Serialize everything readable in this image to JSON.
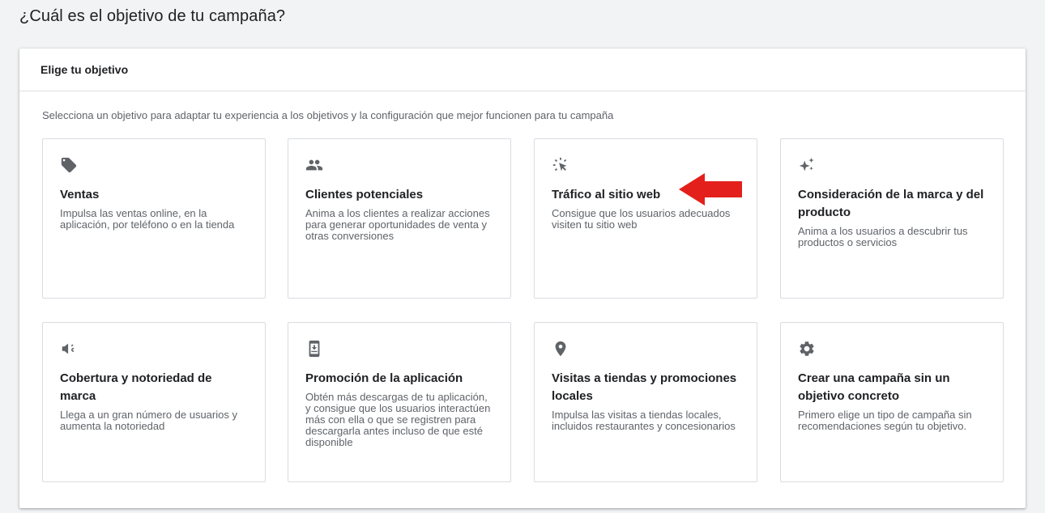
{
  "page": {
    "title": "¿Cuál es el objetivo de tu campaña?"
  },
  "panel": {
    "header": "Elige tu objetivo",
    "description": "Selecciona un objetivo para adaptar tu experiencia a los objetivos y la configuración que mejor funcionen para tu campaña"
  },
  "cards": [
    {
      "icon": "tag-icon",
      "title": "Ventas",
      "description": "Impulsa las ventas online, en la aplicación, por teléfono o en la tienda"
    },
    {
      "icon": "people-icon",
      "title": "Clientes potenciales",
      "description": "Anima a los clientes a realizar acciones para generar oportunidades de venta y otras conversiones"
    },
    {
      "icon": "cursor-click-icon",
      "title": "Tráfico al sitio web",
      "description": "Consigue que los usuarios adecuados visiten tu sitio web"
    },
    {
      "icon": "sparkle-icon",
      "title": "Consideración de la marca y del producto",
      "description": "Anima a los usuarios a descubrir tus productos o servicios"
    },
    {
      "icon": "megaphone-icon",
      "title": "Cobertura y notoriedad de marca",
      "description": "Llega a un gran número de usuarios y aumenta la notoriedad"
    },
    {
      "icon": "phone-download-icon",
      "title": "Promoción de la aplicación",
      "description": "Obtén más descargas de tu aplicación, y consigue que los usuarios interactúen más con ella o que se registren para descargarla antes incluso de que esté disponible"
    },
    {
      "icon": "location-pin-icon",
      "title": "Visitas a tiendas y promociones locales",
      "description": "Impulsa las visitas a tiendas locales, incluidos restaurantes y concesionarios"
    },
    {
      "icon": "gear-icon",
      "title": "Crear una campaña sin un objetivo concreto",
      "description": "Primero elige un tipo de campaña sin recomendaciones según tu objetivo."
    }
  ],
  "annotation": {
    "icon": "red-arrow-left-icon",
    "color": "#e3201b"
  }
}
